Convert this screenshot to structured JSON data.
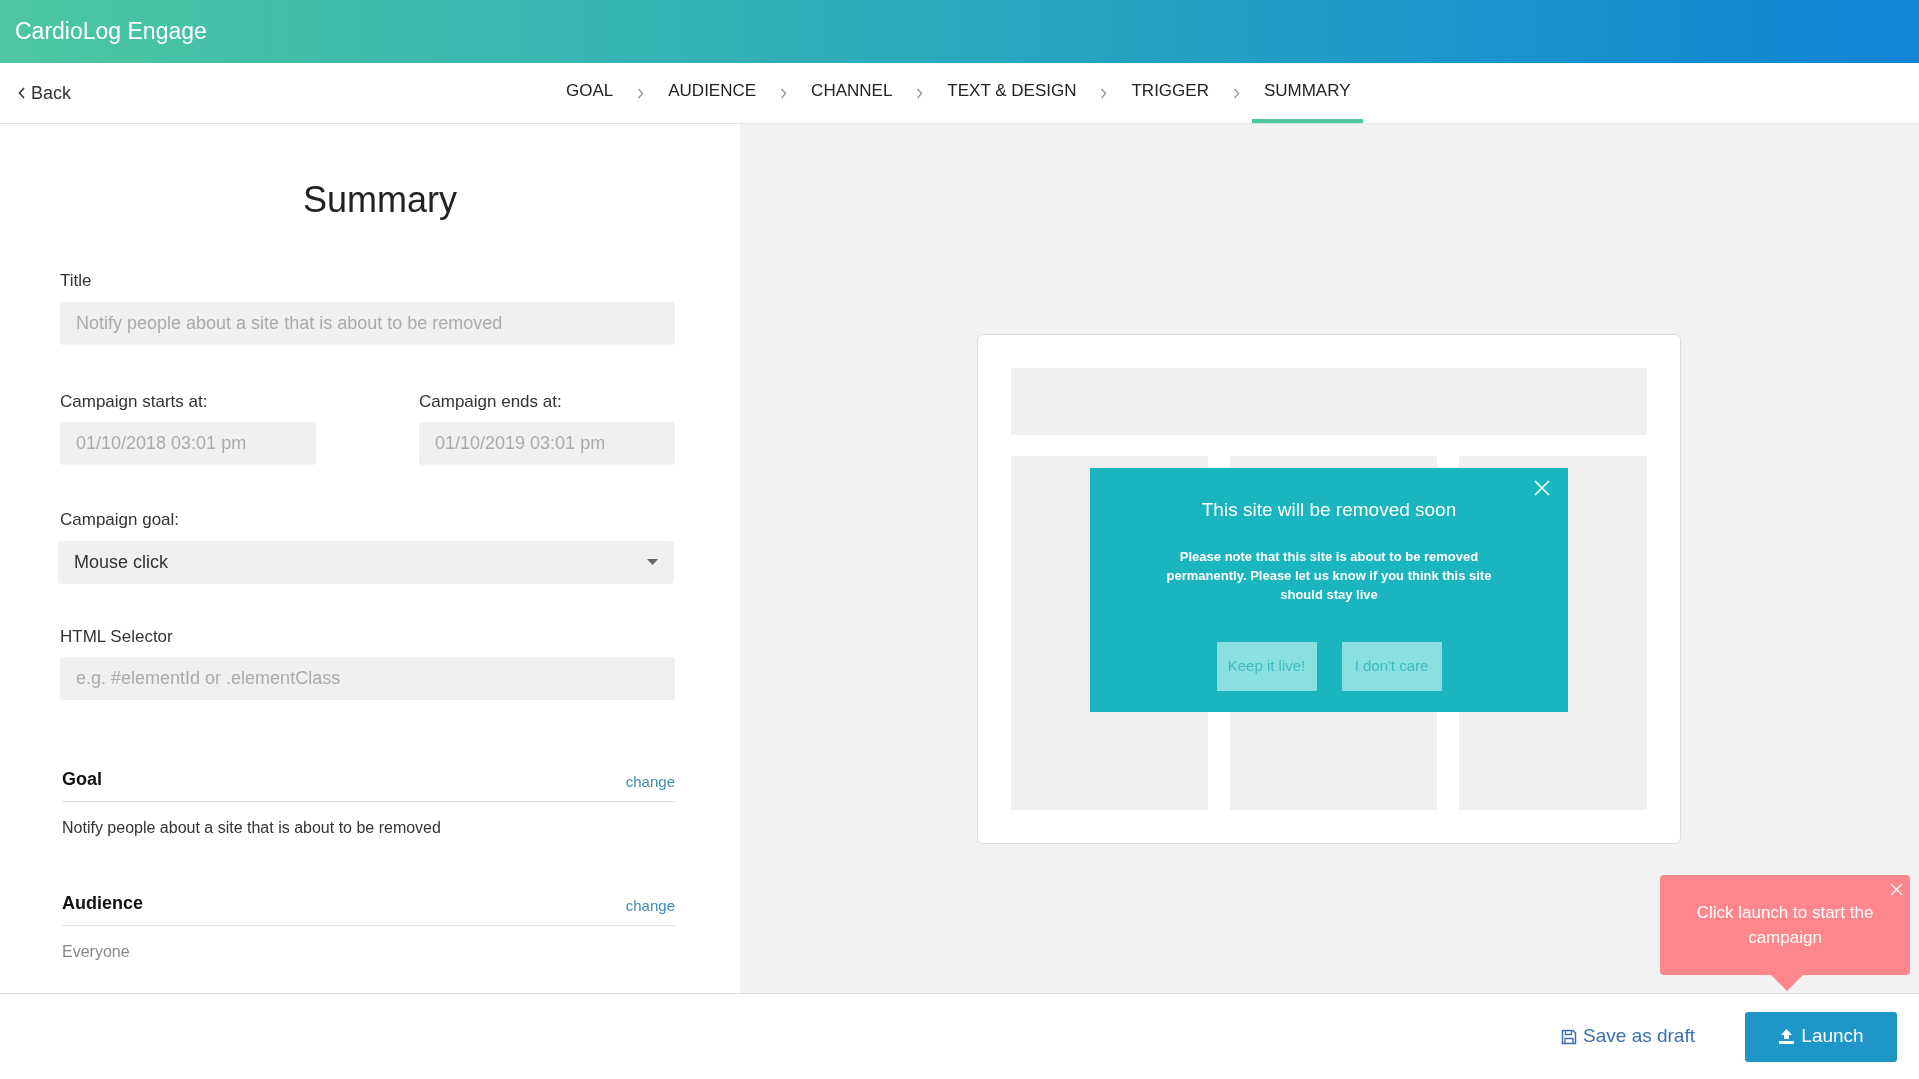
{
  "app": {
    "title": "CardioLog Engage"
  },
  "nav": {
    "back": "Back"
  },
  "steps": [
    {
      "label": "GOAL",
      "selected": false
    },
    {
      "label": "AUDIENCE",
      "selected": false
    },
    {
      "label": "CHANNEL",
      "selected": false
    },
    {
      "label": "TEXT & DESIGN",
      "selected": false
    },
    {
      "label": "TRIGGER",
      "selected": false
    },
    {
      "label": "SUMMARY",
      "selected": true
    }
  ],
  "form": {
    "heading": "Summary",
    "title": {
      "label": "Title",
      "placeholder": "Notify people about a site that is about to be removed"
    },
    "starts": {
      "label": "Campaign starts at:",
      "placeholder": "01/10/2018 03:01 pm"
    },
    "ends": {
      "label": "Campaign ends at:",
      "placeholder": "01/10/2019 03:01 pm"
    },
    "goal": {
      "label": "Campaign goal:",
      "value": "Mouse click"
    },
    "selector": {
      "label": "HTML Selector",
      "placeholder": "e.g. #elementId or .elementClass"
    }
  },
  "sections": [
    {
      "heading": "Goal",
      "action": "change",
      "text": "Notify people about a site that is about to be removed",
      "muted": false
    },
    {
      "heading": "Audience",
      "action": "change",
      "text": "Everyone",
      "muted": true
    }
  ],
  "preview": {
    "popup": {
      "title": "This site will be removed soon",
      "body": "Please note that this site is about to be removed permanently. Please let us know if you think this site should stay live",
      "buttons": [
        "Keep it live!",
        "I don't care"
      ]
    }
  },
  "tooltip": {
    "text": "Click launch to start the campaign"
  },
  "footer": {
    "save": "Save as draft",
    "launch": "Launch"
  }
}
